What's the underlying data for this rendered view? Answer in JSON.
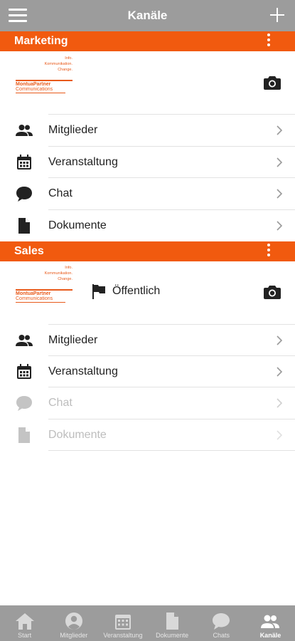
{
  "header": {
    "title": "Kanäle"
  },
  "channels": [
    {
      "name": "Marketing",
      "logo": {
        "tagline": [
          "Info.",
          "Kommunikation.",
          "Change."
        ],
        "brand": "MontuaPartner",
        "brand_sub": "Communications"
      },
      "items": [
        {
          "label": "Mitglieder",
          "icon": "members-icon",
          "disabled": false
        },
        {
          "label": "Veranstaltung",
          "icon": "calendar-icon",
          "disabled": false
        },
        {
          "label": "Chat",
          "icon": "chat-icon",
          "disabled": false
        },
        {
          "label": "Dokumente",
          "icon": "document-icon",
          "disabled": false
        }
      ]
    },
    {
      "name": "Sales",
      "visibility": "Öffentlich",
      "logo": {
        "tagline": [
          "Info.",
          "Kommunikation.",
          "Change."
        ],
        "brand": "MontuaPartner",
        "brand_sub": "Communications"
      },
      "items": [
        {
          "label": "Mitglieder",
          "icon": "members-icon",
          "disabled": false
        },
        {
          "label": "Veranstaltung",
          "icon": "calendar-icon",
          "disabled": false
        },
        {
          "label": "Chat",
          "icon": "chat-icon",
          "disabled": true
        },
        {
          "label": "Dokumente",
          "icon": "document-icon",
          "disabled": true
        }
      ]
    }
  ],
  "tabs": [
    {
      "label": "Start",
      "icon": "home-icon",
      "active": false
    },
    {
      "label": "Mitglieder",
      "icon": "user-icon",
      "active": false
    },
    {
      "label": "Veranstaltung",
      "icon": "calendar-icon",
      "active": false
    },
    {
      "label": "Dokumente",
      "icon": "document-icon",
      "active": false
    },
    {
      "label": "Chats",
      "icon": "chat-icon",
      "active": false
    },
    {
      "label": "Kanäle",
      "icon": "members-icon",
      "active": true
    }
  ],
  "colors": {
    "header": "#9c9c9c",
    "accent": "#f15a0f",
    "disabled": "#bdbdbd"
  }
}
